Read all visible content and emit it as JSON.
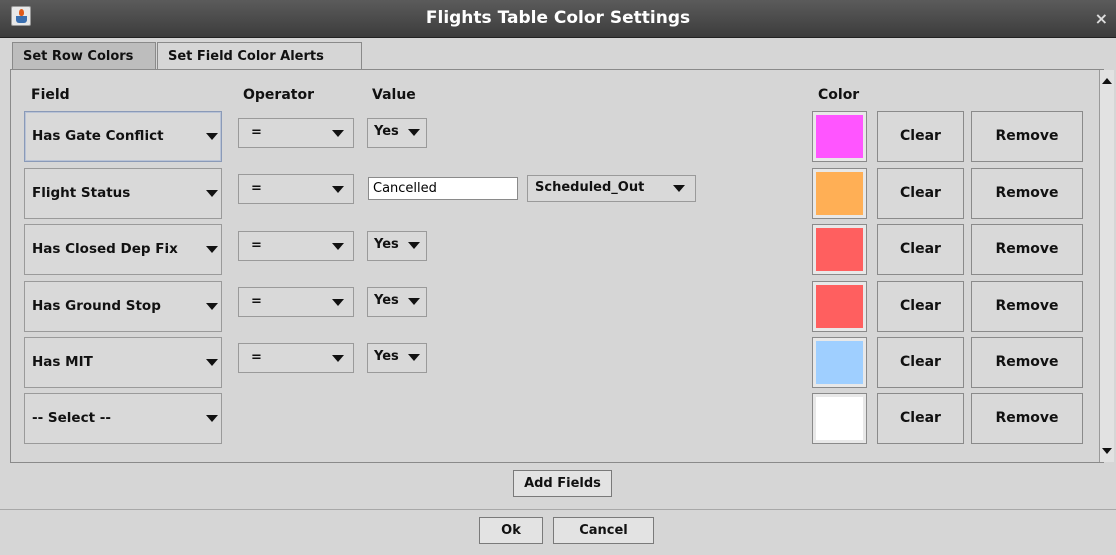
{
  "window": {
    "title": "Flights Table Color Settings",
    "close_glyph": "×",
    "app_icon": "java-cup-icon"
  },
  "tabs": [
    {
      "label": "Set Row Colors",
      "active": true
    },
    {
      "label": "Set Field Color Alerts",
      "active": false
    }
  ],
  "headers": {
    "field": "Field",
    "operator": "Operator",
    "value": "Value",
    "color": "Color"
  },
  "rows": [
    {
      "field": "Has Gate Conflict",
      "operator": "=",
      "value": "Yes",
      "color": "#ff55ff"
    },
    {
      "field": "Flight Status",
      "operator": "=",
      "value_text": "Cancelled",
      "value_select": "Scheduled_Out",
      "color": "#ffaf55"
    },
    {
      "field": "Has Closed Dep Fix",
      "operator": "=",
      "value": "Yes",
      "color": "#ff5f5f"
    },
    {
      "field": "Has Ground Stop",
      "operator": "=",
      "value": "Yes",
      "color": "#ff5f5f"
    },
    {
      "field": "Has MIT",
      "operator": "=",
      "value": "Yes",
      "color": "#9fcfff"
    },
    {
      "field": "-- Select --",
      "color": "#ffffff"
    }
  ],
  "row_buttons": {
    "clear": "Clear",
    "remove": "Remove"
  },
  "add_fields_label": "Add Fields",
  "footer": {
    "ok": "Ok",
    "cancel": "Cancel"
  }
}
